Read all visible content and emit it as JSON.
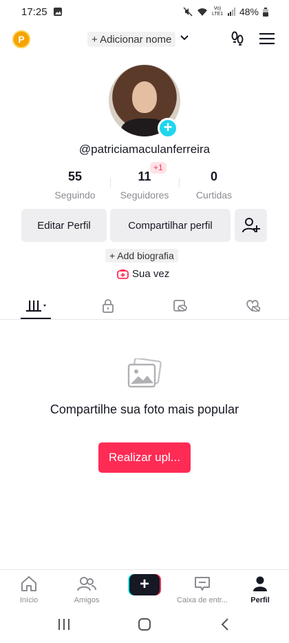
{
  "status": {
    "time": "17:25",
    "battery": "48%",
    "network": "Vo) LTE1"
  },
  "header": {
    "coin": "P",
    "add_name": "+ Adicionar nome"
  },
  "profile": {
    "username": "@patriciamaculanferreira"
  },
  "stats": [
    {
      "value": "55",
      "label": "Seguindo"
    },
    {
      "value": "11",
      "label": "Seguidores",
      "delta": "+1"
    },
    {
      "value": "0",
      "label": "Curtidas"
    }
  ],
  "actions": {
    "edit": "Editar Perfil",
    "share": "Compartilhar perfil"
  },
  "bio": {
    "add": "+ Add biografia"
  },
  "story": {
    "label": "Sua vez"
  },
  "empty": {
    "title": "Compartilhe sua foto mais popular",
    "button": "Realizar upl..."
  },
  "nav": [
    {
      "label": "Início",
      "icon": "home-icon"
    },
    {
      "label": "Amigos",
      "icon": "friends-icon"
    },
    {
      "label": "",
      "icon": "create-icon"
    },
    {
      "label": "Caixa de entr...",
      "icon": "inbox-icon"
    },
    {
      "label": "Perfil",
      "icon": "profile-icon"
    }
  ],
  "colors": {
    "accent": "#fe2c55",
    "cyan": "#20d5ec",
    "text": "#161823",
    "muted": "#8a8b91"
  }
}
